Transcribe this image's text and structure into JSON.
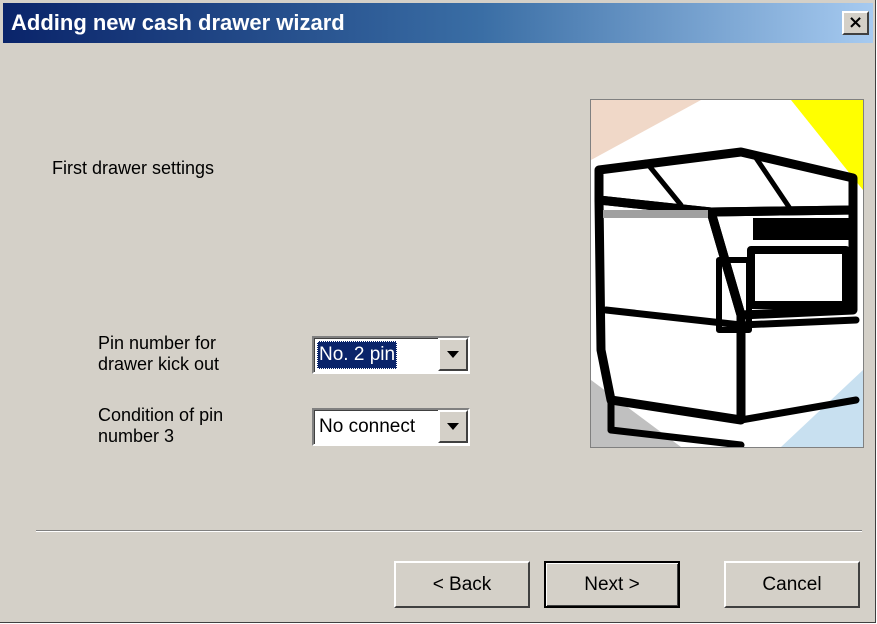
{
  "window": {
    "title": "Adding new cash drawer wizard",
    "close_symbol": "×",
    "title_color_start": "#0a246a",
    "title_color_end": "#a6caf0"
  },
  "page": {
    "heading": "First drawer settings"
  },
  "settings": {
    "pin_number": {
      "label_line1": "Pin number for",
      "label_line2": "drawer kick out",
      "value": "No. 2 pin"
    },
    "pin3_condition": {
      "label_line1": "Condition of pin",
      "label_line2": "number 3",
      "value": "No connect"
    }
  },
  "illustration": {
    "icon": "cash-drawer-icon",
    "accent_yellow": "#ffff00",
    "accent_pink": "#f0d8c8",
    "accent_blue": "#c8e0f0"
  },
  "buttons": {
    "back": "< Back",
    "next": "Next >",
    "cancel": "Cancel"
  }
}
